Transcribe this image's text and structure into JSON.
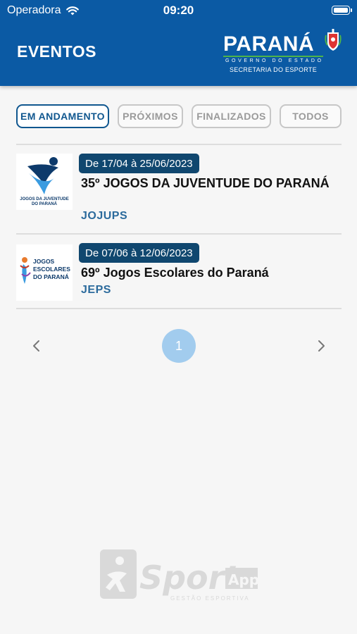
{
  "status_bar": {
    "carrier": "Operadora",
    "time": "09:20"
  },
  "header": {
    "title": "EVENTOS",
    "brand": {
      "name": "PARANÁ",
      "subtitle": "GOVERNO DO ESTADO",
      "department": "SECRETARIA DO ESPORTE"
    }
  },
  "tabs": [
    {
      "label": "EM ANDAMENTO",
      "active": true
    },
    {
      "label": "PRÓXIMOS",
      "active": false
    },
    {
      "label": "FINALIZADOS",
      "active": false
    },
    {
      "label": "TODOS",
      "active": false
    }
  ],
  "events": [
    {
      "date": "De 17/04 à 25/06/2023",
      "title": "35º JOGOS DA JUVENTUDE DO PARANÁ",
      "code": "JOJUPS",
      "logo_text": "JOGOS DA JUVENTUDE DO PARANÁ"
    },
    {
      "date": "De 07/06 à 12/06/2023",
      "title": "69º Jogos Escolares do Paraná",
      "code": "JEPS",
      "logo_text": "JOGOS ESCOLARES DO PARANÁ"
    }
  ],
  "pagination": {
    "current": "1",
    "prev_icon": "chevron-left-icon",
    "next_icon": "chevron-right-icon"
  },
  "footer": {
    "logo_word": "Sport",
    "logo_suffix": "App",
    "logo_tagline": "GESTÃO ESPORTIVA"
  },
  "colors": {
    "header_bg": "#0b5aa4",
    "active_tab": "#10578f",
    "date_badge": "#10476f",
    "event_code": "#2b6a9c",
    "page_dot": "#a2ccee",
    "brand_accent": "#4db34a"
  }
}
